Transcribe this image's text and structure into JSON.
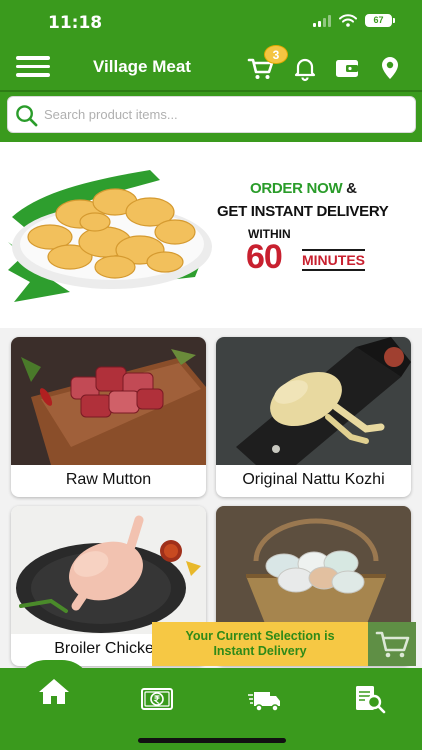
{
  "status_bar": {
    "time": "11:18",
    "battery": "67"
  },
  "header": {
    "title": "Village Meat",
    "cart_count": "3"
  },
  "search": {
    "placeholder": "Search product items..."
  },
  "banner": {
    "order_now": "ORDER NOW",
    "ampersand": "&",
    "instant_delivery": "GET INSTANT DELIVERY",
    "within": "WITHIN",
    "number": "60",
    "minutes": "MINUTES"
  },
  "categories": [
    {
      "label": "Raw Mutton"
    },
    {
      "label": "Original Nattu Kozhi"
    },
    {
      "label": "Broiler Chicken"
    },
    {
      "label": ""
    }
  ],
  "selection_toast": {
    "line1": "Your Current Selection is",
    "line2": "Instant Delivery"
  },
  "bottom_nav": [
    "home",
    "payments",
    "delivery",
    "orders"
  ],
  "colors": {
    "primary": "#3a9a1d",
    "accent": "#f6c844",
    "highlight": "#c8202f"
  }
}
